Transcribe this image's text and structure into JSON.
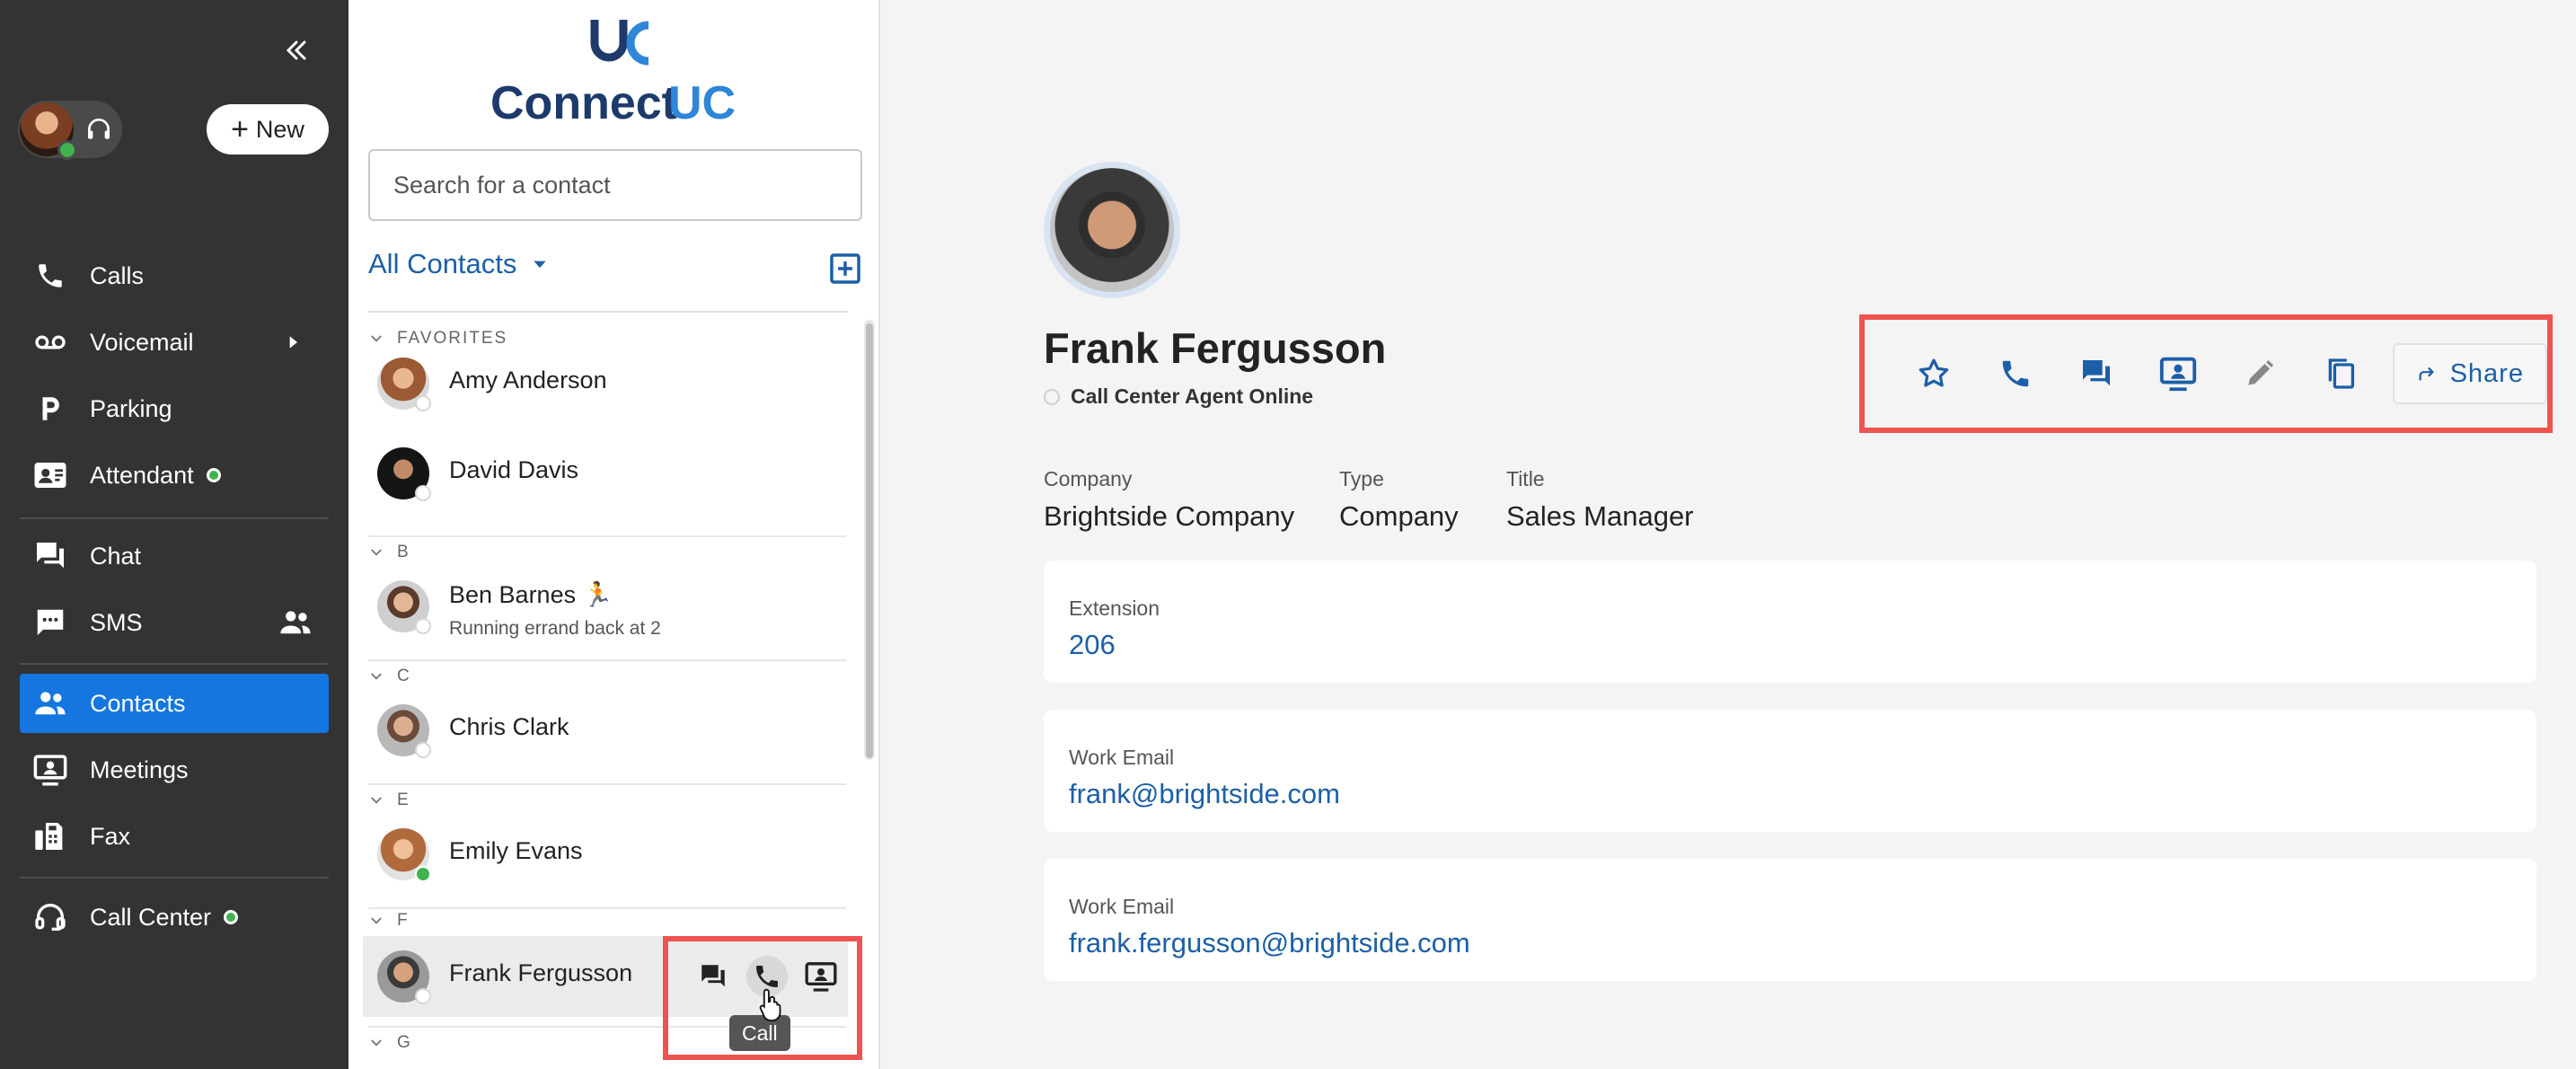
{
  "nav": {
    "new_label": "New",
    "items": [
      {
        "label": "Calls",
        "icon": "phone-icon"
      },
      {
        "label": "Voicemail",
        "icon": "voicemail-icon"
      },
      {
        "label": "Parking",
        "icon": "parking-icon"
      },
      {
        "label": "Attendant",
        "icon": "attendant-icon"
      },
      {
        "label": "Chat",
        "icon": "chat-icon"
      },
      {
        "label": "SMS",
        "icon": "sms-icon"
      },
      {
        "label": "Contacts",
        "icon": "contacts-icon",
        "active": true
      },
      {
        "label": "Meetings",
        "icon": "meetings-icon"
      },
      {
        "label": "Fax",
        "icon": "fax-icon"
      },
      {
        "label": "Call Center",
        "icon": "headset-icon"
      }
    ]
  },
  "list": {
    "logo_text_main": "Connect",
    "logo_text_accent": "UC",
    "search_placeholder": "Search for a contact",
    "filter_label": "All Contacts",
    "sections": {
      "favorites": "FAVORITES",
      "b": "B",
      "c": "C",
      "e": "E",
      "f": "F",
      "g": "G"
    },
    "contacts": {
      "amy": "Amy Anderson",
      "david": "David Davis",
      "ben": "Ben Barnes 🏃",
      "ben_status": "Running errand back at 2",
      "chris": "Chris Clark",
      "emily": "Emily Evans",
      "frank": "Frank Fergusson"
    },
    "tooltip": "Call"
  },
  "detail": {
    "name": "Frank Fergusson",
    "presence": "Call Center Agent Online",
    "share_label": "Share",
    "company_label": "Company",
    "company_value": "Brightside Company",
    "type_label": "Type",
    "type_value": "Company",
    "title_label": "Title",
    "title_value": "Sales Manager",
    "fields": [
      {
        "label": "Extension",
        "value": "206"
      },
      {
        "label": "Work Email",
        "value": "frank@brightside.com"
      },
      {
        "label": "Work Email",
        "value": "frank.fergusson@brightside.com"
      }
    ]
  },
  "colors": {
    "accent": "#1476de",
    "link": "#1c5fa8",
    "highlight": "#ef5350",
    "online": "#3fb34f",
    "nav_bg": "#333333"
  }
}
